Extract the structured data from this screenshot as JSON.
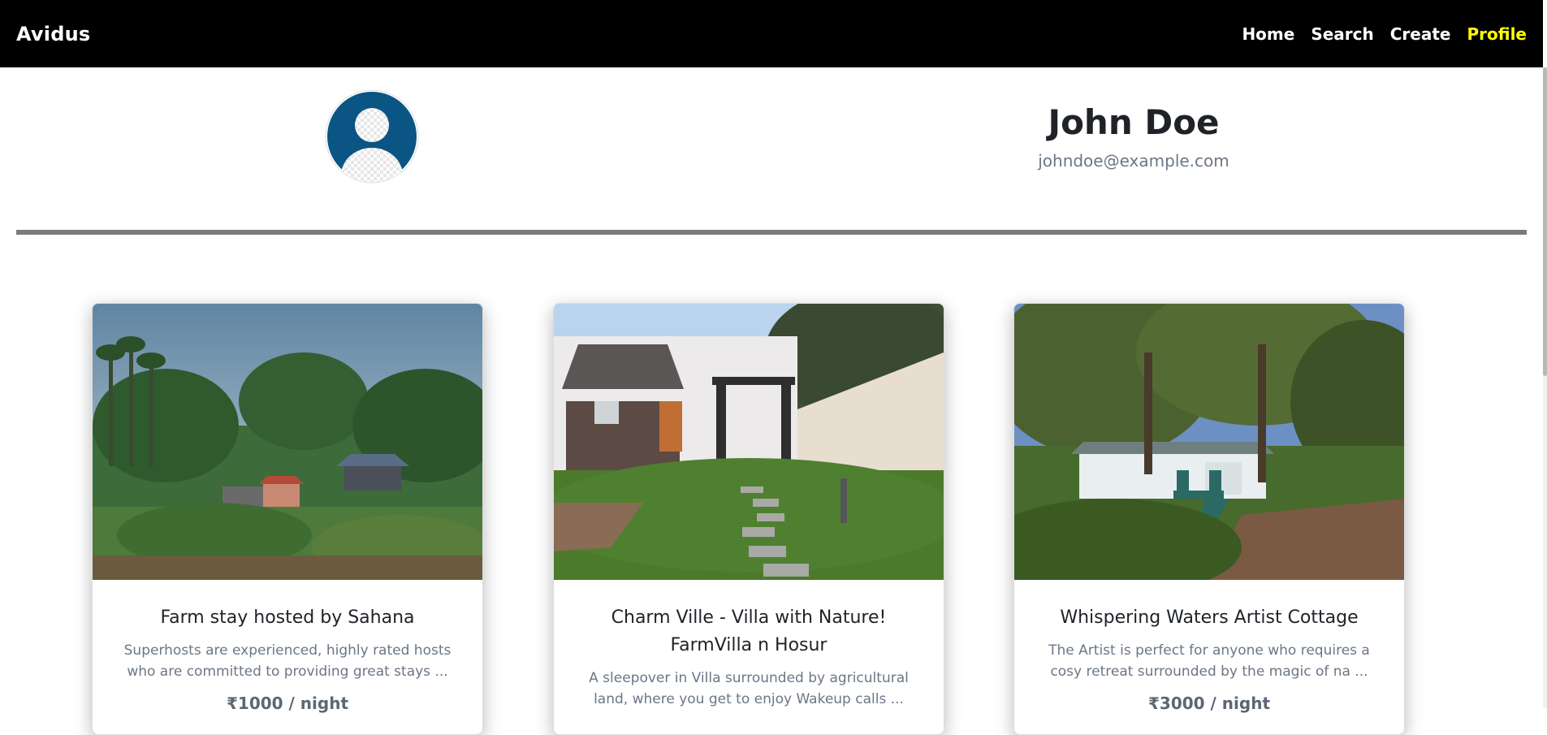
{
  "nav": {
    "brand": "Avidus",
    "links": [
      "Home",
      "Search",
      "Create",
      "Profile"
    ],
    "active_color": "#ffff00"
  },
  "profile": {
    "name": "John Doe",
    "email": "johndoe@example.com",
    "avatar_icon": "user-avatar-icon"
  },
  "listings": [
    {
      "title": "Farm stay hosted by Sahana",
      "description": "Superhosts are experienced, highly rated hosts who are committed to providing great stays ...",
      "price": "₹1000 / night"
    },
    {
      "title": "Charm Ville - Villa with Nature! FarmVilla n Hosur",
      "description": "A sleepover in Villa surrounded by agricultural land, where you get to enjoy Wakeup calls ...",
      "price": ""
    },
    {
      "title": "Whispering Waters Artist Cottage",
      "description": "The Artist is perfect for anyone who requires a cosy retreat surrounded by the magic of na ...",
      "price": "₹3000 / night"
    }
  ]
}
